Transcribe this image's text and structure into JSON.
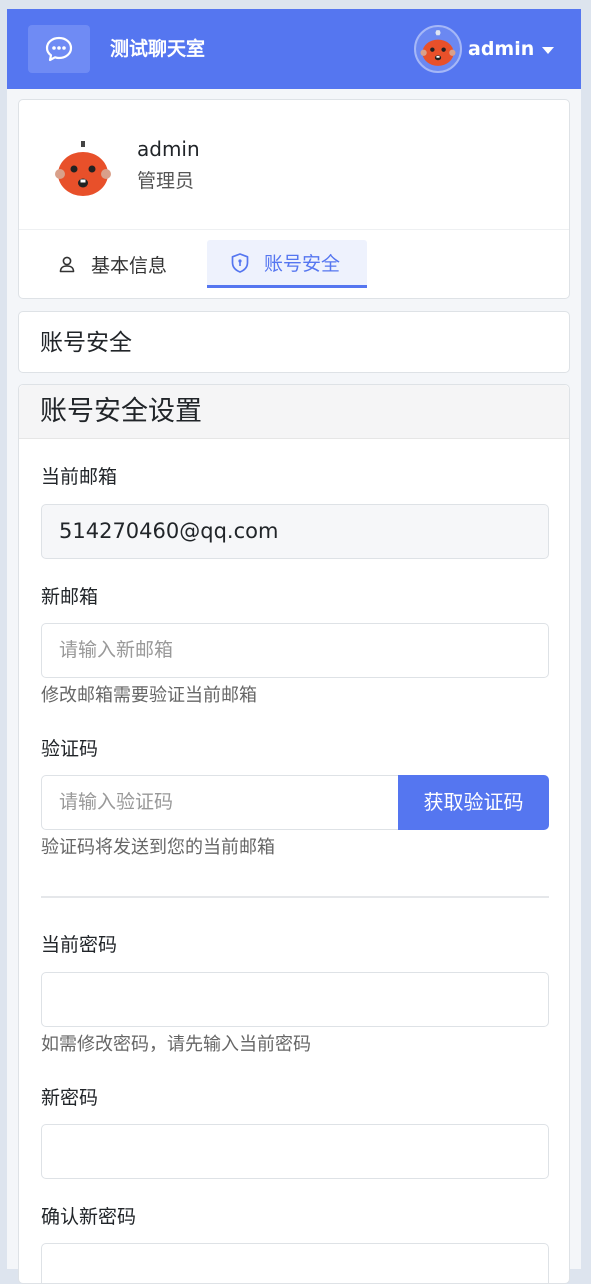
{
  "navbar": {
    "brand": "测试聊天室",
    "username": "admin",
    "icons": {
      "chat": "chat-bubble-icon",
      "caret": "caret-down-icon"
    }
  },
  "profile": {
    "name": "admin",
    "role": "管理员",
    "tabs": [
      {
        "label": "基本信息",
        "icon": "user-icon",
        "active": false
      },
      {
        "label": "账号安全",
        "icon": "shield-icon",
        "active": true
      }
    ]
  },
  "section": {
    "title": "账号安全"
  },
  "form": {
    "title": "账号安全设置",
    "current_email": {
      "label": "当前邮箱",
      "value": "514270460@qq.com"
    },
    "new_email": {
      "label": "新邮箱",
      "placeholder": "请输入新邮箱",
      "hint": "修改邮箱需要验证当前邮箱"
    },
    "code": {
      "label": "验证码",
      "placeholder": "请输入验证码",
      "button": "获取验证码",
      "hint": "验证码将发送到您的当前邮箱"
    },
    "current_password": {
      "label": "当前密码",
      "hint": "如需修改密码，请先输入当前密码"
    },
    "new_password": {
      "label": "新密码"
    },
    "confirm_password": {
      "label": "确认新密码"
    }
  },
  "colors": {
    "primary": "#5576f0",
    "avatar": "#e8502a"
  }
}
